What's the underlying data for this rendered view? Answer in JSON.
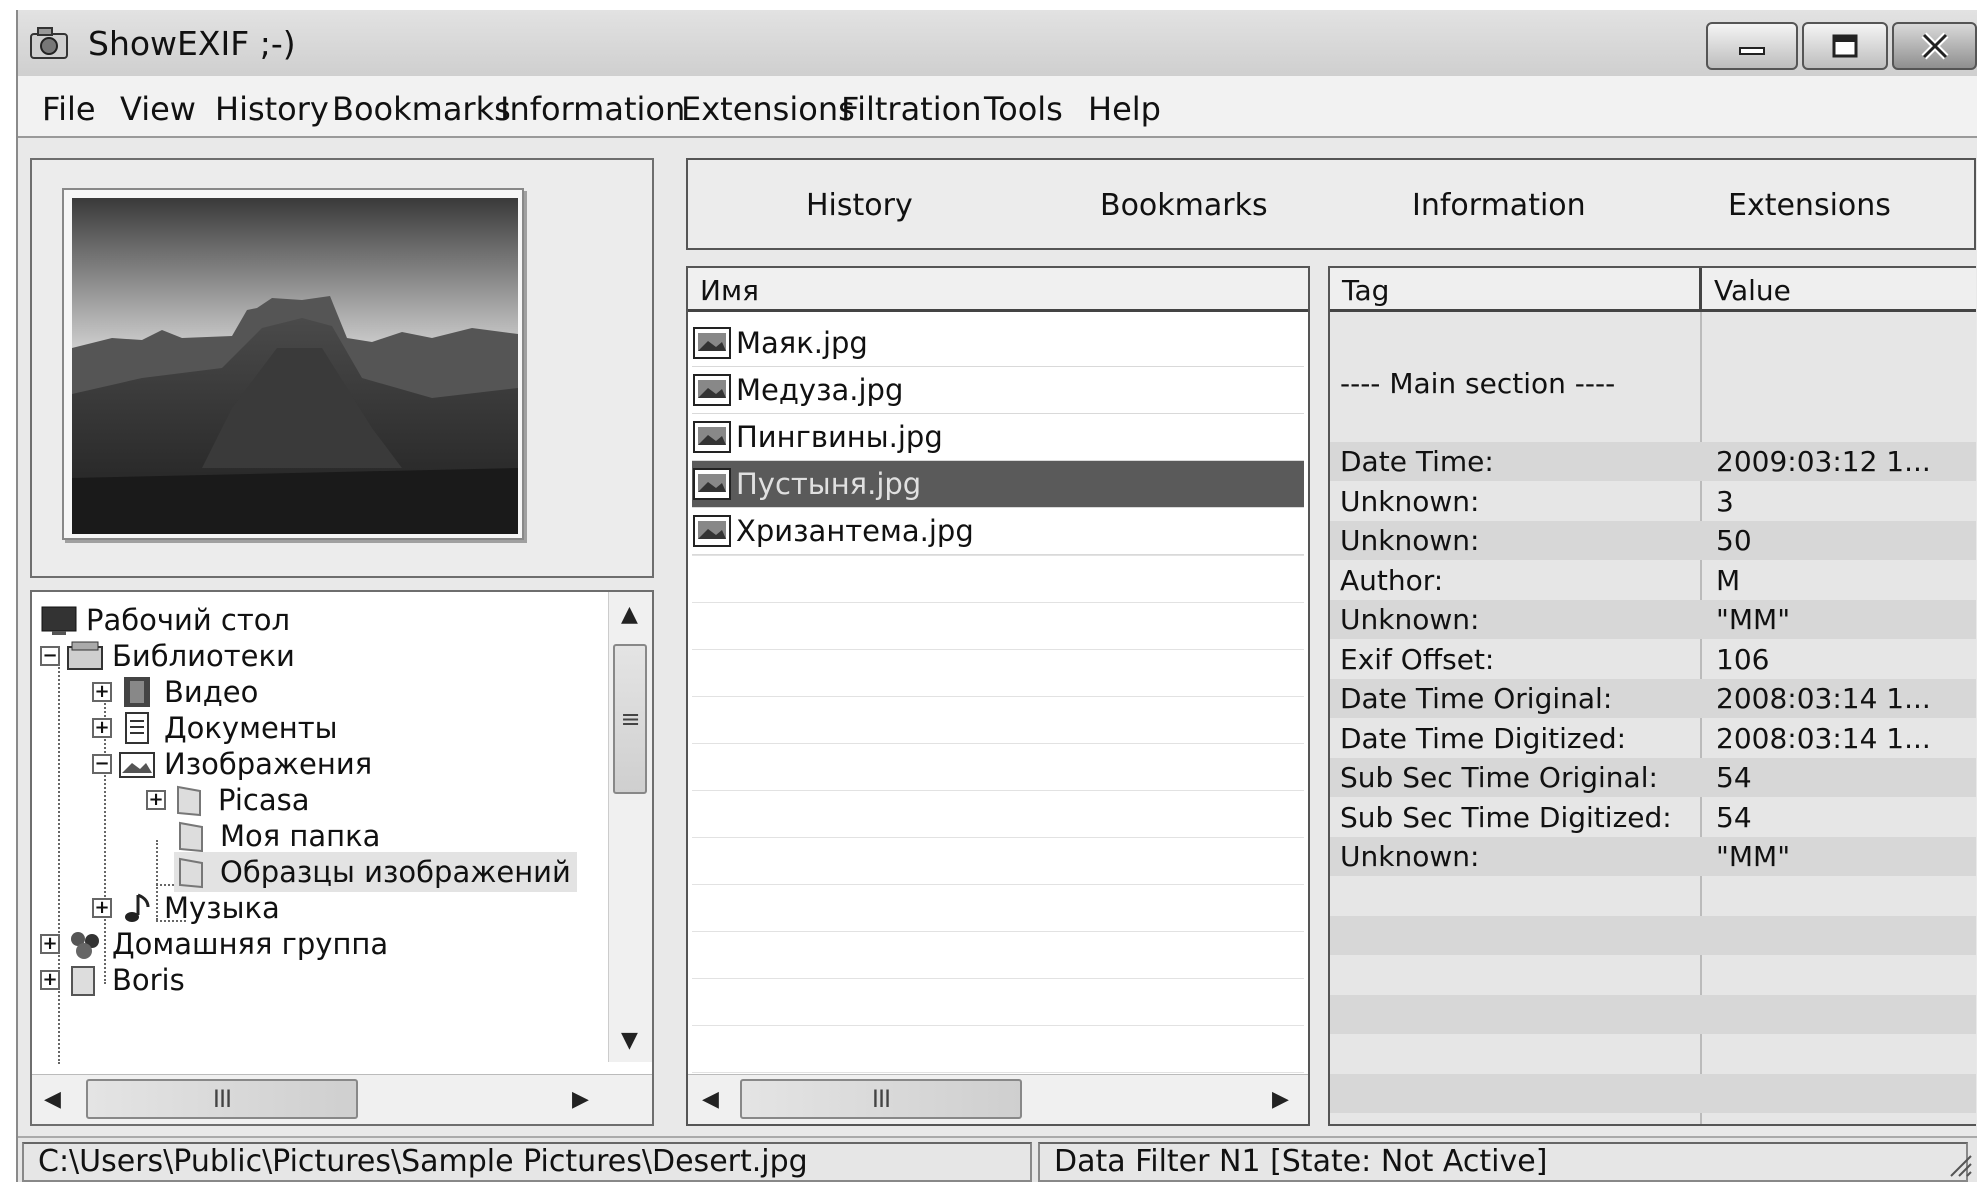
{
  "window": {
    "title": "ShowEXIF ;-)"
  },
  "menu": {
    "items": [
      "File",
      "View",
      "History",
      "Bookmarks",
      "Information",
      "Extensions",
      "Filtration",
      "Tools",
      "Help"
    ]
  },
  "tabs": {
    "items": [
      "History",
      "Bookmarks",
      "Information",
      "Extensions"
    ]
  },
  "tree": {
    "items": [
      {
        "label": "Рабочий стол",
        "icon": "desktop-icon"
      },
      {
        "label": "Библиотеки",
        "icon": "libraries-icon",
        "expander": "−"
      },
      {
        "label": "Видео",
        "icon": "video-icon",
        "expander": "+"
      },
      {
        "label": "Документы",
        "icon": "documents-icon",
        "expander": "+"
      },
      {
        "label": "Изображения",
        "icon": "pictures-icon",
        "expander": "−"
      },
      {
        "label": "Picasa",
        "icon": "folder-icon",
        "expander": "+"
      },
      {
        "label": "Моя папка",
        "icon": "folder-icon"
      },
      {
        "label": "Образцы изображений",
        "icon": "folder-icon"
      },
      {
        "label": "Музыка",
        "icon": "music-icon",
        "expander": "+"
      },
      {
        "label": "Домашняя группа",
        "icon": "homegroup-icon",
        "expander": "+"
      },
      {
        "label": "Boris",
        "icon": "user-folder-icon",
        "expander": "+"
      }
    ]
  },
  "files": {
    "header": "Имя",
    "items": [
      "Маяк.jpg",
      "Медуза.jpg",
      "Пингвины.jpg",
      "Пустыня.jpg",
      "Хризантема.jpg"
    ],
    "selected_index": 3
  },
  "tags": {
    "header_tag": "Tag",
    "header_value": "Value",
    "section": "---- Main section ----",
    "rows": [
      {
        "tag": "Date Time:",
        "value": "2009:03:12 1..."
      },
      {
        "tag": "Unknown:",
        "value": "3"
      },
      {
        "tag": "Unknown:",
        "value": "50"
      },
      {
        "tag": "Author:",
        "value": "M"
      },
      {
        "tag": "Unknown:",
        "value": "\"MM\""
      },
      {
        "tag": "Exif Offset:",
        "value": "106"
      },
      {
        "tag": "Date Time Original:",
        "value": "2008:03:14 1..."
      },
      {
        "tag": "Date Time Digitized:",
        "value": "2008:03:14 1..."
      },
      {
        "tag": "Sub Sec Time Original:",
        "value": "54"
      },
      {
        "tag": "Sub Sec Time Digitized:",
        "value": "54"
      },
      {
        "tag": "Unknown:",
        "value": "\"MM\""
      }
    ]
  },
  "scrollbars": {
    "thumb_glyph": "III",
    "vthumb_glyph": "≡"
  },
  "status": {
    "path": "C:\\Users\\Public\\Pictures\\Sample Pictures\\Desert.jpg",
    "filter": "Data Filter N1 [State: Not Active]"
  }
}
